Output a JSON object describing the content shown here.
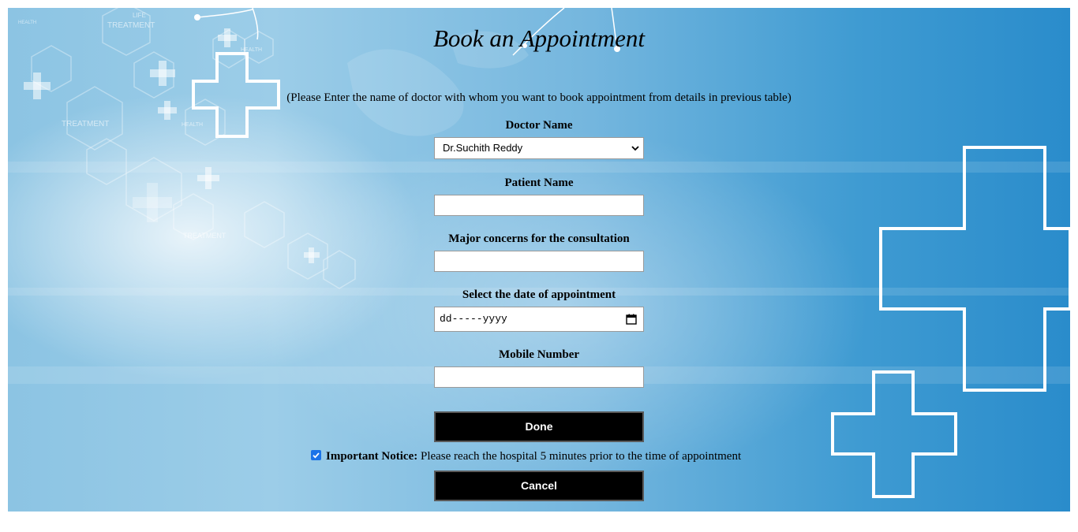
{
  "page": {
    "title": "Book an Appointment",
    "hint": "(Please Enter the name of doctor with whom you want to book appointment from details in previous table)"
  },
  "form": {
    "doctor_label": "Doctor Name",
    "doctor_selected": "Dr.Suchith Reddy",
    "patient_label": "Patient Name",
    "patient_value": "",
    "concerns_label": "Major concerns for the consultation",
    "concerns_value": "",
    "date_label": "Select the date of appointment",
    "date_placeholder": "dd-----yyyy",
    "mobile_label": "Mobile Number",
    "mobile_value": ""
  },
  "buttons": {
    "done": "Done",
    "cancel": "Cancel"
  },
  "notice": {
    "checked": true,
    "heading": "Important Notice:",
    "text": "Please reach the hospital 5 minutes prior to the time of appointment"
  },
  "background": {
    "words": [
      "TREATMENT",
      "HEALTH",
      "HEALTH",
      "TREATMENT",
      "TREATMENT",
      "LIFE",
      "HEALTH"
    ]
  },
  "colors": {
    "primary_button": "#000000",
    "checkbox_accent": "#1a73e8"
  }
}
